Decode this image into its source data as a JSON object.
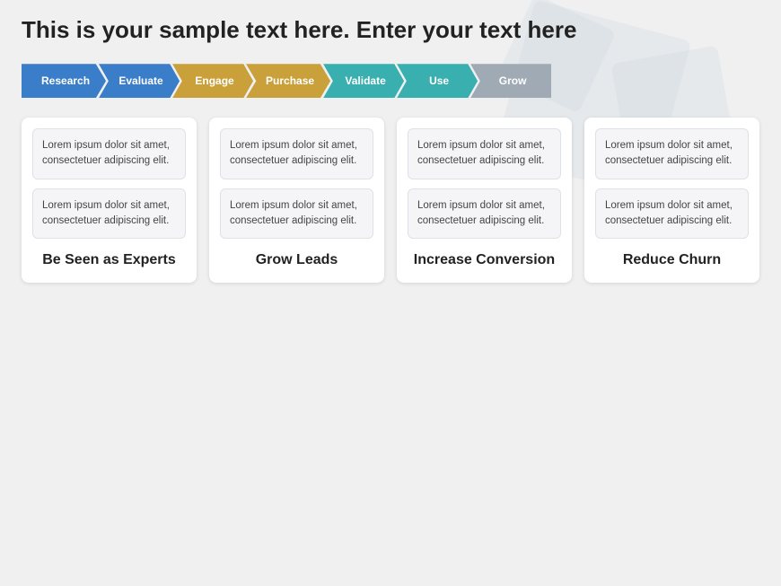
{
  "title": "This is your sample text here. Enter your text here",
  "process": {
    "steps": [
      {
        "id": "research",
        "label": "Research",
        "color": "blue"
      },
      {
        "id": "evaluate",
        "label": "Evaluate",
        "color": "blue"
      },
      {
        "id": "engage",
        "label": "Engage",
        "color": "gold"
      },
      {
        "id": "purchase",
        "label": "Purchase",
        "color": "gold"
      },
      {
        "id": "validate",
        "label": "Validate",
        "color": "teal"
      },
      {
        "id": "use",
        "label": "Use",
        "color": "teal"
      },
      {
        "id": "grow",
        "label": "Grow",
        "color": "silver",
        "last": true
      }
    ]
  },
  "cards": [
    {
      "id": "be-seen",
      "box1": "Lorem ipsum dolor sit amet, consectetuer adipiscing elit.",
      "box2": "Lorem ipsum dolor sit amet, consectetuer adipiscing elit.",
      "label": "Be Seen as Experts"
    },
    {
      "id": "grow-leads",
      "box1": "Lorem ipsum dolor sit amet, consectetuer adipiscing elit.",
      "box2": "Lorem ipsum dolor sit amet, consectetuer adipiscing elit.",
      "label": "Grow Leads"
    },
    {
      "id": "increase-conversion",
      "box1": "Lorem ipsum dolor sit amet, consectetuer adipiscing elit.",
      "box2": "Lorem ipsum dolor sit amet, consectetuer adipiscing elit.",
      "label": "Increase Conversion"
    },
    {
      "id": "reduce-churn",
      "box1": "Lorem ipsum dolor sit amet, consectetuer adipiscing elit.",
      "box2": "Lorem ipsum dolor sit amet, consectetuer adipiscing elit.",
      "label": "Reduce Churn"
    }
  ]
}
